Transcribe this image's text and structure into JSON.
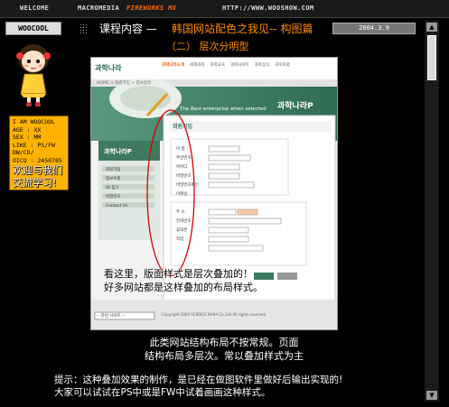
{
  "topbar": {
    "welcome": "WELCOME",
    "macromedia": "MACROMEDIA",
    "fireworks": "FIREWORKS MX",
    "url": "HTTP://WWW.WOOSHOW.COM"
  },
  "header": {
    "logo": "WOOCOOL",
    "course": "课程内容 —",
    "title": "韩国网站配色之我见-- 构图篇",
    "date": "2004.3.9"
  },
  "section_title": "（二） 层次分明型",
  "profile": {
    "lines": [
      "I AM WOOCOOL",
      "AGE : XX",
      "SEX : MM",
      "LIKE : PS/FW",
      "DW/CD/",
      "OICQ : 2450785"
    ],
    "welcome1": "欢迎与我们",
    "welcome2": "交流学习!"
  },
  "screenshot": {
    "site_logo": "과학나라",
    "nav": [
      "과학나라소개",
      "세계과학",
      "과학교육",
      "과학사이트",
      "과학상식",
      "과학포럼"
    ],
    "crumbs": "HOME > 회원가입 > 정보입력",
    "banner_text": "The Best enterprise when selected",
    "brand": "과학나라P",
    "side_title": "과학나라P",
    "side_items": [
      "회원가입",
      "정보수정",
      "ID 찾기",
      "비밀번호",
      "Contact Us"
    ],
    "form_title": "회원가입",
    "form_labels": [
      "이 름",
      "주민번호",
      "아이디",
      "비밀번호",
      "비밀번호확인",
      "이메일"
    ],
    "form_labels2": [
      "주 소",
      "전화번호",
      "휴대폰",
      "직업"
    ],
    "select_text": "-- 관련 사이트 --",
    "footer_text": "Copyright 2004 SCIENCE NARA Co.,Ltd All rights reserved.",
    "overlay_line1": "看这里，版面样式是层次叠加的！",
    "overlay_line2": "好多网站都是这样叠加的布局样式。"
  },
  "caption": {
    "line1": "此类网站结构布局不按常规。页面",
    "line2": "结构布局多层次。常以叠加样式为主"
  },
  "tip": {
    "line1": "提示：这种叠加效果的制作，是已经在做图软件里做好后输出实现的!",
    "line2": "大家可以试试在PS中或是FW中试着画画这种样式。"
  },
  "colors": {
    "accent": "#ff8a00",
    "site_green": "#3f7a5e"
  }
}
